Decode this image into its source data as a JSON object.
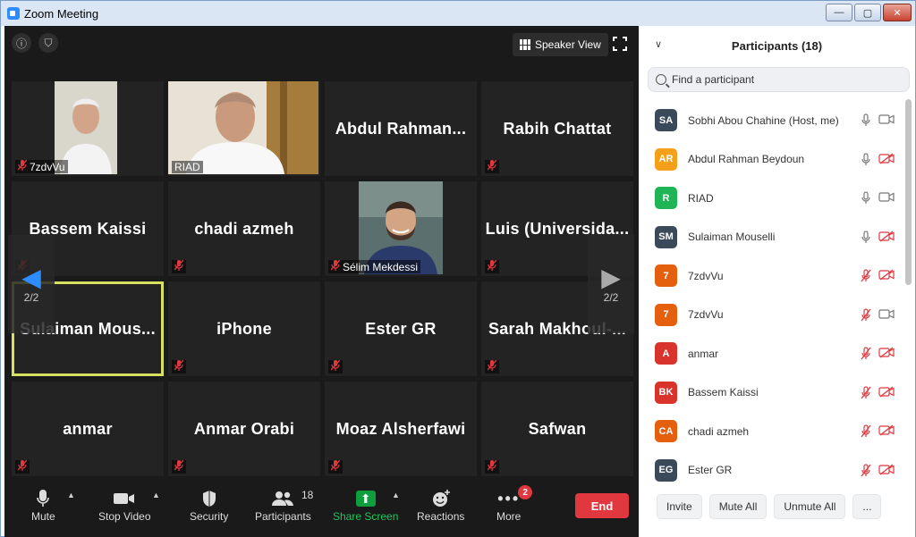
{
  "window": {
    "title": "Zoom Meeting",
    "minimize": "—",
    "maximize": "▢",
    "close": "✕"
  },
  "video": {
    "info_icon": "ⓘ",
    "shield_icon": "⛉",
    "speaker_view": "Speaker View",
    "tiles": [
      {
        "name": "",
        "label": "7zdvVu",
        "mic_off": true,
        "photo": "man-older"
      },
      {
        "name": "",
        "label": "RIAD",
        "mic_off": false,
        "photo": "man-suit"
      },
      {
        "name": "Abdul  Rahman...",
        "label": "",
        "mic_off": false
      },
      {
        "name": "Rabih Chattat",
        "label": "",
        "mic_off": true
      },
      {
        "name": "Bassem Kaissi",
        "label": "",
        "mic_off": true
      },
      {
        "name": "chadi azmeh",
        "label": "",
        "mic_off": true
      },
      {
        "name": "",
        "label": "Sélim Mekdessi",
        "mic_off": true,
        "photo": "man-beard"
      },
      {
        "name": "Luis  (Universida...",
        "label": "",
        "mic_off": true
      },
      {
        "name": "Sulaiman  Mous...",
        "label": "",
        "mic_off": false,
        "active": true
      },
      {
        "name": "iPhone",
        "label": "",
        "mic_off": true
      },
      {
        "name": "Ester GR",
        "label": "",
        "mic_off": true
      },
      {
        "name": "Sarah  Makhoul-...",
        "label": "",
        "mic_off": true
      },
      {
        "name": "anmar",
        "label": "",
        "mic_off": true
      },
      {
        "name": "Anmar Orabi",
        "label": "",
        "mic_off": true
      },
      {
        "name": "Moaz Alsherfawi",
        "label": "",
        "mic_off": true
      },
      {
        "name": "Safwan",
        "label": "",
        "mic_off": true
      }
    ],
    "page_left": "2/2",
    "page_right": "2/2"
  },
  "toolbar": {
    "mute": "Mute",
    "stop_video": "Stop Video",
    "security": "Security",
    "participants": "Participants",
    "participants_count": "18",
    "share_screen": "Share Screen",
    "reactions": "Reactions",
    "more": "More",
    "more_badge": "2",
    "end": "End"
  },
  "panel": {
    "title": "Participants (18)",
    "search_placeholder": "Find a participant",
    "participants": [
      {
        "initials": "SA",
        "name": "Sobhi Abou Chahine (Host, me)",
        "color": "#3b4a5a",
        "mic_off": false,
        "cam_off": false
      },
      {
        "initials": "AR",
        "name": "Abdul Rahman Beydoun",
        "color": "#f5a01a",
        "mic_off": false,
        "cam_off": true
      },
      {
        "initials": "R",
        "name": "RIAD",
        "color": "#1fb456",
        "mic_off": false,
        "cam_off": false
      },
      {
        "initials": "SM",
        "name": "Sulaiman Mouselli",
        "color": "#3b4a5a",
        "mic_off": false,
        "cam_off": true
      },
      {
        "initials": "7",
        "name": "7zdvVu",
        "color": "#e4600f",
        "mic_off": true,
        "cam_off": true
      },
      {
        "initials": "7",
        "name": "7zdvVu",
        "color": "#e4600f",
        "mic_off": true,
        "cam_off": false
      },
      {
        "initials": "A",
        "name": "anmar",
        "color": "#d9342b",
        "mic_off": true,
        "cam_off": true
      },
      {
        "initials": "BK",
        "name": "Bassem Kaissi",
        "color": "#d9342b",
        "mic_off": true,
        "cam_off": true
      },
      {
        "initials": "CA",
        "name": "chadi azmeh",
        "color": "#e4600f",
        "mic_off": true,
        "cam_off": true
      },
      {
        "initials": "EG",
        "name": "Ester GR",
        "color": "#3b4a5a",
        "mic_off": true,
        "cam_off": true
      }
    ],
    "invite": "Invite",
    "mute_all": "Mute All",
    "unmute_all": "Unmute All",
    "more": "..."
  }
}
